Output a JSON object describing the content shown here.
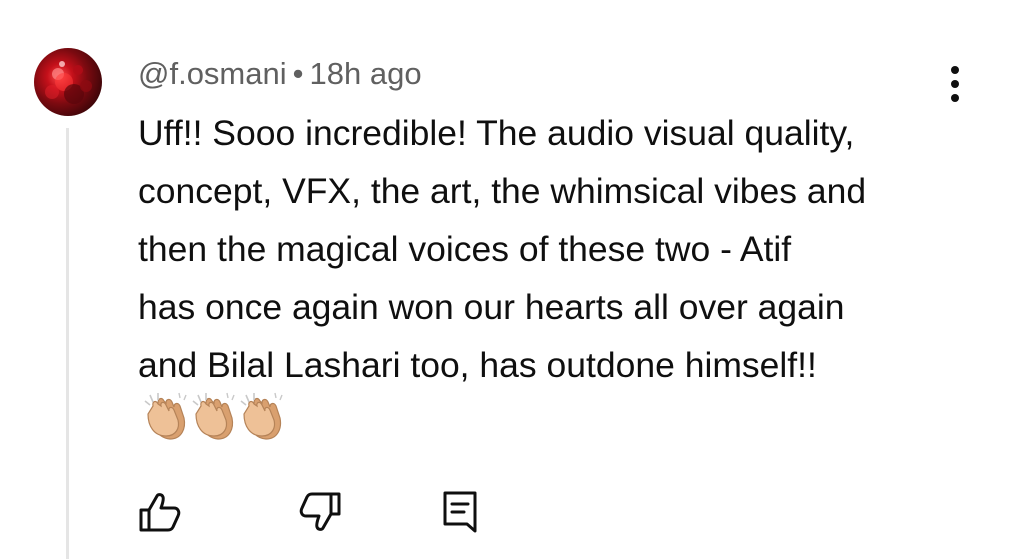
{
  "comment": {
    "author": "@f.osmani",
    "separator": "•",
    "timestamp": "18h ago",
    "text_lines": [
      "Uff!! Sooo incredible! The audio visual quality,",
      "concept, VFX, the art, the whimsical vibes and",
      "then the magical voices of these two - Atif",
      "has once again won our hearts all over again",
      "and Bilal Lashari too, has outdone himself!!"
    ],
    "emojis": [
      "clapping-hands",
      "clapping-hands",
      "clapping-hands"
    ]
  },
  "icons": {
    "more": "more-vertical-icon",
    "like": "thumbs-up-icon",
    "dislike": "thumbs-down-icon",
    "reply": "reply-comment-icon"
  },
  "colors": {
    "text": "#0f0f0f",
    "meta": "#606060",
    "thread_line": "#e5e5e5",
    "avatar_red": "#c5101a",
    "emoji_skin": "#e8b48a"
  }
}
